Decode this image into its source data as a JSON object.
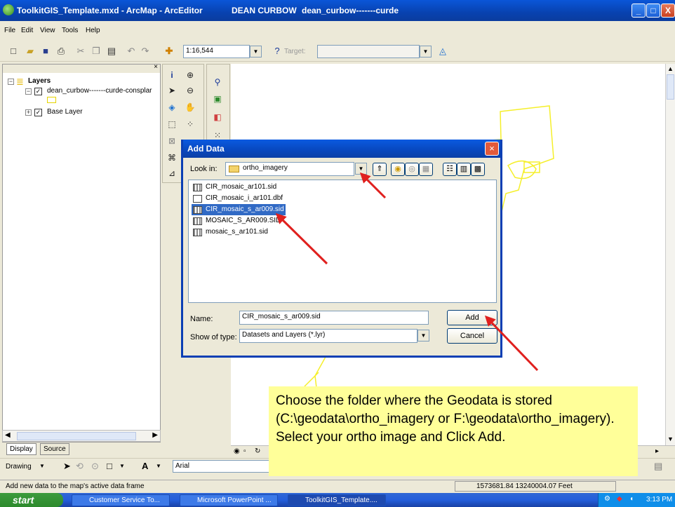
{
  "window": {
    "title": "ToolkitGIS_Template.mxd - ArcMap - ArcEditor",
    "user": "DEAN CURBOW",
    "instance": "dean_curbow-------curde",
    "buttons": {
      "minimize": "_",
      "maximize": "□",
      "close": "X"
    }
  },
  "menu": {
    "items": [
      "File",
      "Edit",
      "View",
      "Tools",
      "Help"
    ]
  },
  "toolbar": {
    "scale": "1:16,544",
    "target_label": "Target:",
    "target_value": ""
  },
  "toc": {
    "root_label": "Layers",
    "layers": [
      {
        "name": "dean_curbow-------curde-consplar",
        "checked": true
      },
      {
        "name": "Base Layer",
        "checked": true
      }
    ],
    "tabs": [
      "Display",
      "Source"
    ]
  },
  "drawing": {
    "drawing_label": "Drawing",
    "font": "Arial"
  },
  "status": {
    "message": "Add new data to the map's active data frame",
    "coords": "1573681.84  13240004.07 Feet"
  },
  "taskbar": {
    "start_label": "start",
    "tasks": [
      "Customer Service To...",
      "Microsoft PowerPoint ...",
      "ToolkitGIS_Template...."
    ],
    "time": "3:13 PM"
  },
  "dialog": {
    "title": "Add Data",
    "look_in_label": "Look in:",
    "look_in_value": "ortho_imagery",
    "files": [
      {
        "name": "CIR_mosaic_ar101.sid",
        "selected": false
      },
      {
        "name": "CIR_mosaic_i_ar101.dbf",
        "selected": false
      },
      {
        "name": "CIR_mosaic_s_ar009.sid",
        "selected": true
      },
      {
        "name": "MOSAIC_S_AR009.SID",
        "selected": false
      },
      {
        "name": "mosaic_s_ar101.sid",
        "selected": false
      }
    ],
    "name_label": "Name:",
    "name_value": "CIR_mosaic_s_ar009.sid",
    "type_label": "Show of type:",
    "type_value": "Datasets and Layers (*.lyr)",
    "add_label": "Add",
    "cancel_label": "Cancel"
  },
  "callout": {
    "text": "Choose the folder where the Geodata is stored (C:\\geodata\\ortho_imagery or F:\\geodata\\ortho_imagery). Select your ortho image and Click Add."
  },
  "colors": {
    "arrow": "#e0201e",
    "map_lines": "#ffff33",
    "selection": "#316ac5",
    "callout_bg": "#ffff99"
  }
}
